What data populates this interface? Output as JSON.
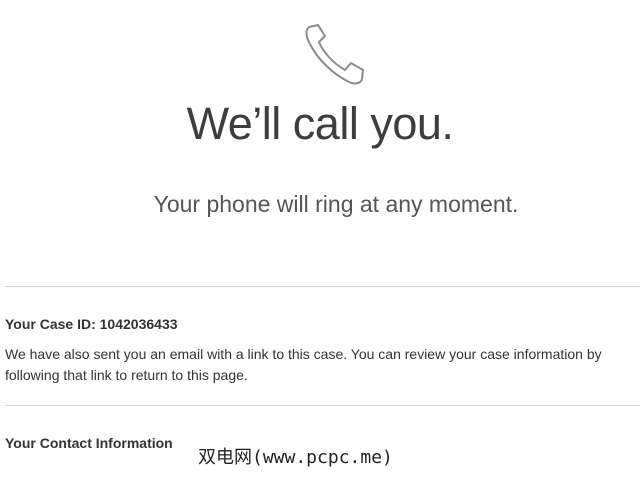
{
  "hero": {
    "icon": "phone-icon",
    "headline": "We’ll call you.",
    "subline": "Your phone will ring at any moment."
  },
  "case": {
    "title": "Your Case ID: 1042036433",
    "body": "We have also sent you an email with a link to this case. You can review your case information by following that link to return to this page."
  },
  "contact": {
    "title": "Your Contact Information"
  },
  "watermark": {
    "text": "双电网(www.pcpc.me)"
  },
  "colors": {
    "text": "#333333",
    "divider": "#d6d6d6",
    "icon": "#888888"
  }
}
